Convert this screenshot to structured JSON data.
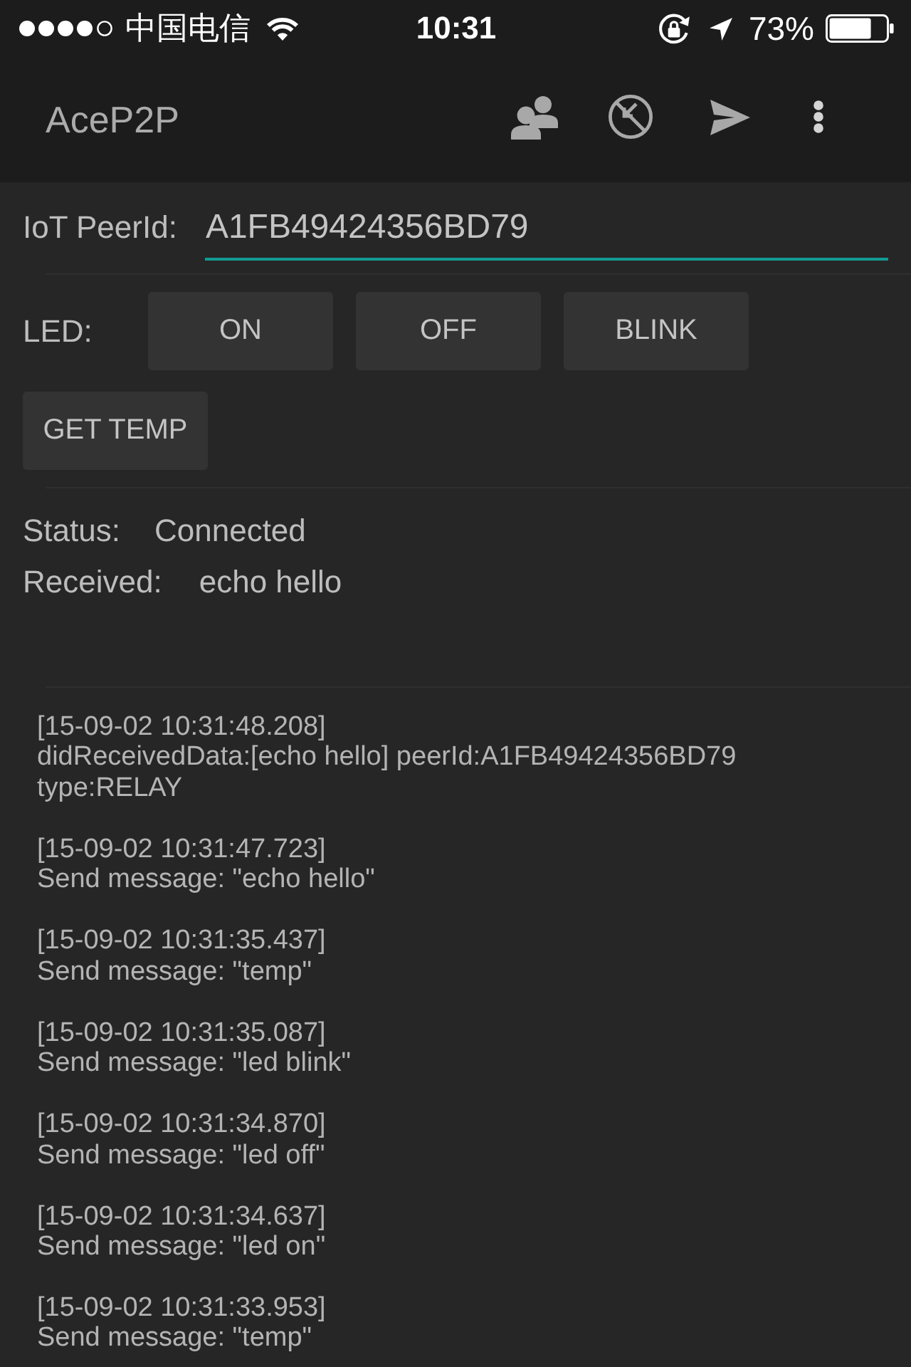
{
  "status_bar": {
    "carrier": "中国电信",
    "time": "10:31",
    "battery": "73%"
  },
  "app_bar": {
    "title": "AceP2P"
  },
  "peer_field": {
    "label": "IoT PeerId:",
    "value": "A1FB49424356BD79"
  },
  "led": {
    "label": "LED:",
    "buttons": [
      "ON",
      "OFF",
      "BLINK"
    ]
  },
  "get_temp_button": "GET TEMP",
  "status": {
    "label": "Status:",
    "value": "Connected"
  },
  "received": {
    "label": "Received:",
    "value": "echo hello"
  },
  "log": [
    {
      "time": "[15-09-02 10:31:48.208]",
      "message": "didReceivedData:[echo hello] peerId:A1FB49424356BD79\ntype:RELAY"
    },
    {
      "time": "[15-09-02 10:31:47.723]",
      "message": "Send message: \"echo hello\""
    },
    {
      "time": "[15-09-02 10:31:35.437]",
      "message": "Send message: \"temp\""
    },
    {
      "time": "[15-09-02 10:31:35.087]",
      "message": "Send message: \"led blink\""
    },
    {
      "time": "[15-09-02 10:31:34.870]",
      "message": "Send message: \"led off\""
    },
    {
      "time": "[15-09-02 10:31:34.637]",
      "message": "Send message: \"led on\""
    },
    {
      "time": "[15-09-02 10:31:33.953]",
      "message": "Send message: \"temp\""
    }
  ]
}
